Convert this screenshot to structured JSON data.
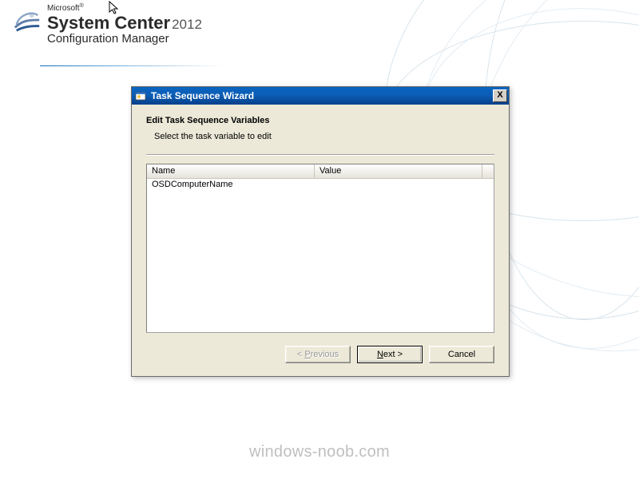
{
  "branding": {
    "vendor": "Microsoft",
    "product_bold": "System Center",
    "product_year": "2012",
    "subtitle": "Configuration Manager"
  },
  "dialog": {
    "title": "Task Sequence Wizard",
    "close_label": "X",
    "heading": "Edit Task Sequence Variables",
    "instruction": "Select the task variable to edit",
    "columns": {
      "name": "Name",
      "value": "Value"
    },
    "rows": [
      {
        "name": "OSDComputerName",
        "value": ""
      }
    ],
    "buttons": {
      "previous": "< Previous",
      "next": "Next >",
      "cancel": "Cancel"
    }
  },
  "watermark": "windows-noob.com"
}
